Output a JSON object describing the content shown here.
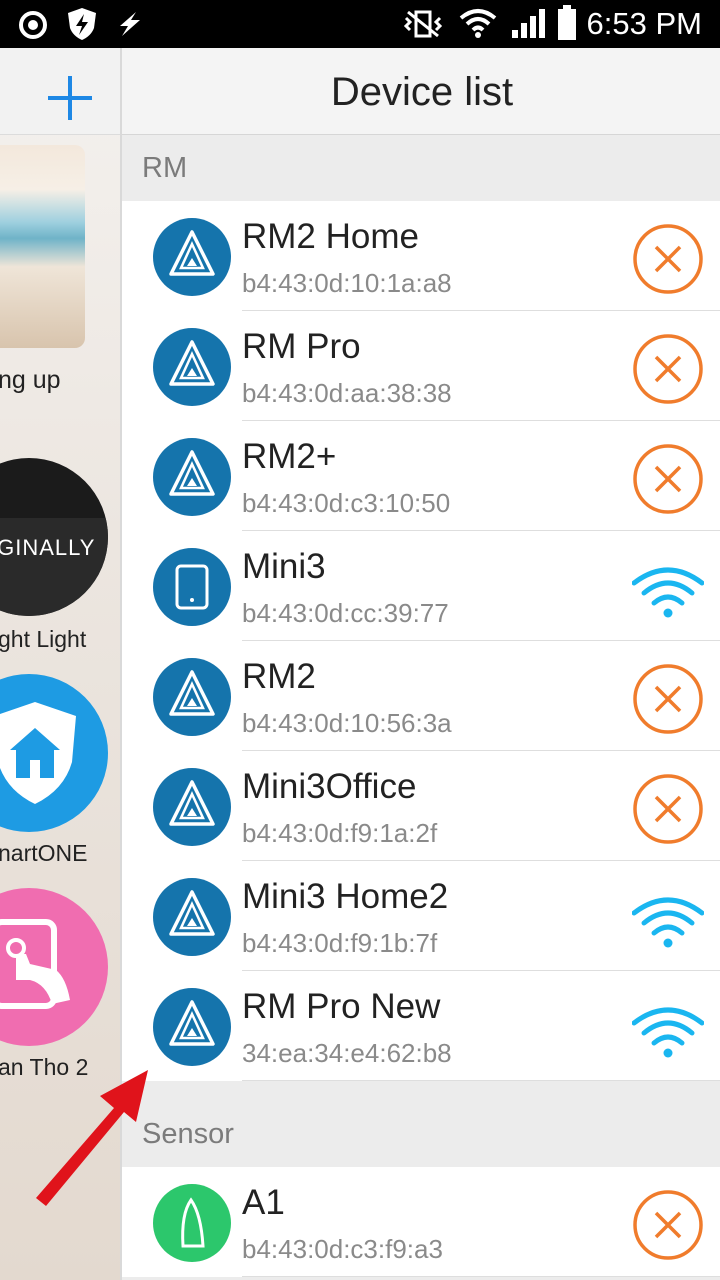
{
  "status_bar": {
    "time": "6:53 PM"
  },
  "left_panel": {
    "scene_labels": [
      "ng up",
      "ght Light",
      "nartONE",
      "an Tho 2"
    ],
    "badge_text": "IGINALLY"
  },
  "header": {
    "title": "Device list"
  },
  "sections": [
    {
      "label": "RM"
    },
    {
      "label": "Sensor"
    }
  ],
  "devices": [
    {
      "name": "RM2 Home",
      "mac": "b4:43:0d:10:1a:a8",
      "icon": "rm-triangle-icon",
      "status": "offline"
    },
    {
      "name": "RM Pro",
      "mac": "b4:43:0d:aa:38:38",
      "icon": "rm-triangle-icon",
      "status": "offline"
    },
    {
      "name": "RM2+",
      "mac": "b4:43:0d:c3:10:50",
      "icon": "rm-triangle-icon",
      "status": "offline"
    },
    {
      "name": "Mini3",
      "mac": "b4:43:0d:cc:39:77",
      "icon": "mini-device-icon",
      "status": "online"
    },
    {
      "name": "RM2",
      "mac": "b4:43:0d:10:56:3a",
      "icon": "rm-triangle-icon",
      "status": "offline"
    },
    {
      "name": "Mini3Office",
      "mac": "b4:43:0d:f9:1a:2f",
      "icon": "rm-triangle-icon",
      "status": "offline"
    },
    {
      "name": "Mini3 Home2",
      "mac": "b4:43:0d:f9:1b:7f",
      "icon": "rm-triangle-icon",
      "status": "online"
    },
    {
      "name": "RM Pro New",
      "mac": "34:ea:34:e4:62:b8",
      "icon": "rm-triangle-icon",
      "status": "online"
    },
    {
      "name": "A1",
      "mac": "b4:43:0d:c3:f9:a3",
      "icon": "a1-sensor-icon",
      "status": "offline"
    }
  ],
  "colors": {
    "accent_blue": "#1e88e5",
    "device_icon_blue": "#1574ac",
    "sensor_green": "#2cc76c",
    "offline_orange": "#f07c2c",
    "wifi_cyan": "#1ab6f0",
    "pointer_arrow_red": "#e0131b"
  }
}
